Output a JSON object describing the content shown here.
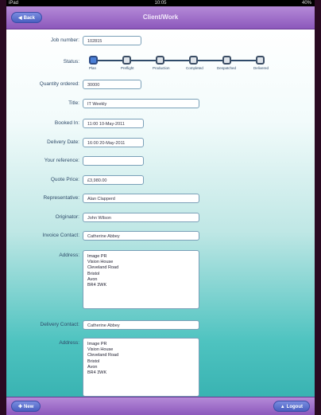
{
  "statusbar": {
    "device": "iPad",
    "time": "10:05",
    "battery": "40%"
  },
  "navbar": {
    "title": "Client/Work",
    "back_label": "Back"
  },
  "form": {
    "job_number": {
      "label": "Job number:",
      "value": "102815"
    },
    "status": {
      "label": "Status:",
      "steps": [
        "Plan",
        "Preflight",
        "Production",
        "Completed",
        "Despatched",
        "Delivered"
      ],
      "current_index": 0
    },
    "quantity": {
      "label": "Quantity ordered:",
      "value": "30000"
    },
    "title": {
      "label": "Title:",
      "value": "IT Weekly"
    },
    "booked_in": {
      "label": "Booked In:",
      "value": "11:00 10-May-2011"
    },
    "delivery_date": {
      "label": "Delivery Date:",
      "value": "16:00 20-May-2011"
    },
    "your_reference": {
      "label": "Your reference:",
      "value": ""
    },
    "quote_price": {
      "label": "Quote Price:",
      "value": "£3,980.00"
    },
    "representative": {
      "label": "Representative:",
      "value": "Alan Clapperd"
    },
    "originator": {
      "label": "Originator:",
      "value": "John Wilson"
    },
    "invoice_contact": {
      "label": "Invoice Contact:",
      "value": "Catherine Abbey"
    },
    "invoice_address": {
      "label": "Address:",
      "lines": [
        "Image PR",
        "Vision House",
        "Cleveland Road",
        "Bristol",
        "Avon",
        "BR4 3WK"
      ]
    },
    "delivery_contact": {
      "label": "Delivery Contact:",
      "value": "Catherine Abbey"
    },
    "delivery_address": {
      "label": "Address:",
      "lines": [
        "Image PR",
        "Vision House",
        "Cleveland Road",
        "Bristol",
        "Avon",
        "BR4 3WK"
      ]
    }
  },
  "bottombar": {
    "left_label": "New",
    "right_label": "Logout"
  },
  "colors": {
    "nav": "#9a6ac8",
    "button": "#5a6fd0",
    "accent": "#39b3b2"
  }
}
